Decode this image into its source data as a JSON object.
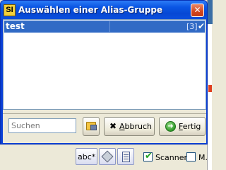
{
  "dialog": {
    "app_icon_text": "SI",
    "title": "Auswählen einer Alias-Gruppe",
    "close_glyph": "✕"
  },
  "list": {
    "rows": [
      {
        "name": "test",
        "count": "[3]",
        "checked": true,
        "check_glyph": "✔"
      }
    ]
  },
  "search": {
    "placeholder": "Suchen",
    "value": ""
  },
  "buttons": {
    "cancel": {
      "icon": "x-icon",
      "glyph": "✖",
      "label_prefix": "",
      "label_accel": "A",
      "label_rest": "bbruch"
    },
    "done": {
      "icon": "go-arrow-icon",
      "glyph": "➜",
      "label_prefix": "",
      "label_accel": "F",
      "label_rest": "ertig"
    },
    "open_icon": "folder-lookup-icon"
  },
  "toolbar": {
    "spell_label": "abc*",
    "tag_icon": "tag-icon",
    "calc_icon": "calculator-icon"
  },
  "options": {
    "scanner": {
      "label": "Scanner",
      "checked": true,
      "tick": "✔"
    },
    "m": {
      "label": "M.",
      "checked": false
    }
  },
  "colors": {
    "title_bar": "#0a56e4",
    "selection": "#316ac5",
    "window_bg": "#ece9d8"
  }
}
